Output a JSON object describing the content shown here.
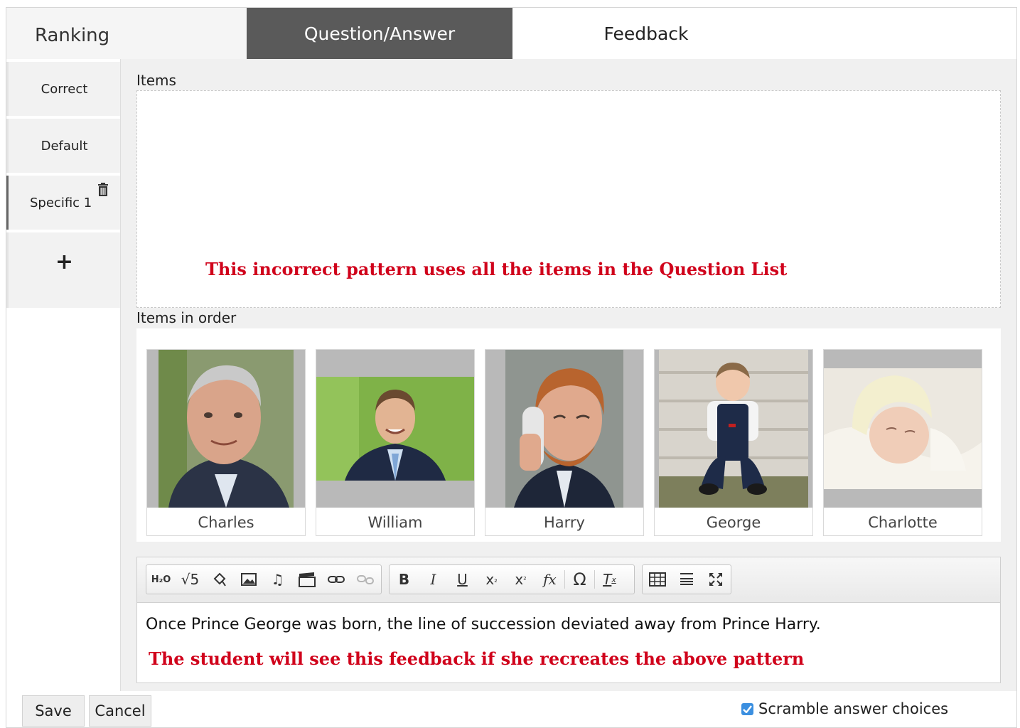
{
  "header": {
    "app_title": "Ranking",
    "tabs": [
      {
        "label": "Question/Answer",
        "active": true
      },
      {
        "label": "Feedback",
        "active": false
      }
    ]
  },
  "sidebar": {
    "items": [
      {
        "label": "Correct"
      },
      {
        "label": "Default"
      },
      {
        "label": "Specific 1",
        "selected": true,
        "icon": "trash-icon"
      },
      {
        "label": "+",
        "icon": "plus-icon"
      }
    ]
  },
  "main": {
    "items_label": "Items",
    "items_note": "This incorrect pattern uses all the items in the Question List",
    "order_label": "Items in order",
    "ordered_items": [
      {
        "name": "Charles"
      },
      {
        "name": "William"
      },
      {
        "name": "Harry"
      },
      {
        "name": "George"
      },
      {
        "name": "Charlotte"
      }
    ]
  },
  "editor": {
    "toolbar_icons": [
      "chemistry-icon",
      "sqrt-icon",
      "shape-icon",
      "image-icon",
      "audio-icon",
      "video-icon",
      "link-icon",
      "unlink-icon",
      "bold-icon",
      "italic-icon",
      "underline-icon",
      "subscript-icon",
      "superscript-icon",
      "formula-icon",
      "special-char-icon",
      "remove-format-icon",
      "table-icon",
      "horizontal-rule-icon",
      "maximize-icon"
    ],
    "text": "Once Prince George was born, the line of succession deviated away from Prince Harry.",
    "note": "The student will see this feedback if she recreates the above pattern"
  },
  "footer": {
    "save_label": "Save",
    "cancel_label": "Cancel",
    "scramble_label": "Scramble answer choices",
    "scramble_checked": true
  },
  "colors": {
    "annotation_red": "#d0021b",
    "active_tab": "#5a5a5a",
    "checkbox_blue": "#3b8fe0"
  }
}
